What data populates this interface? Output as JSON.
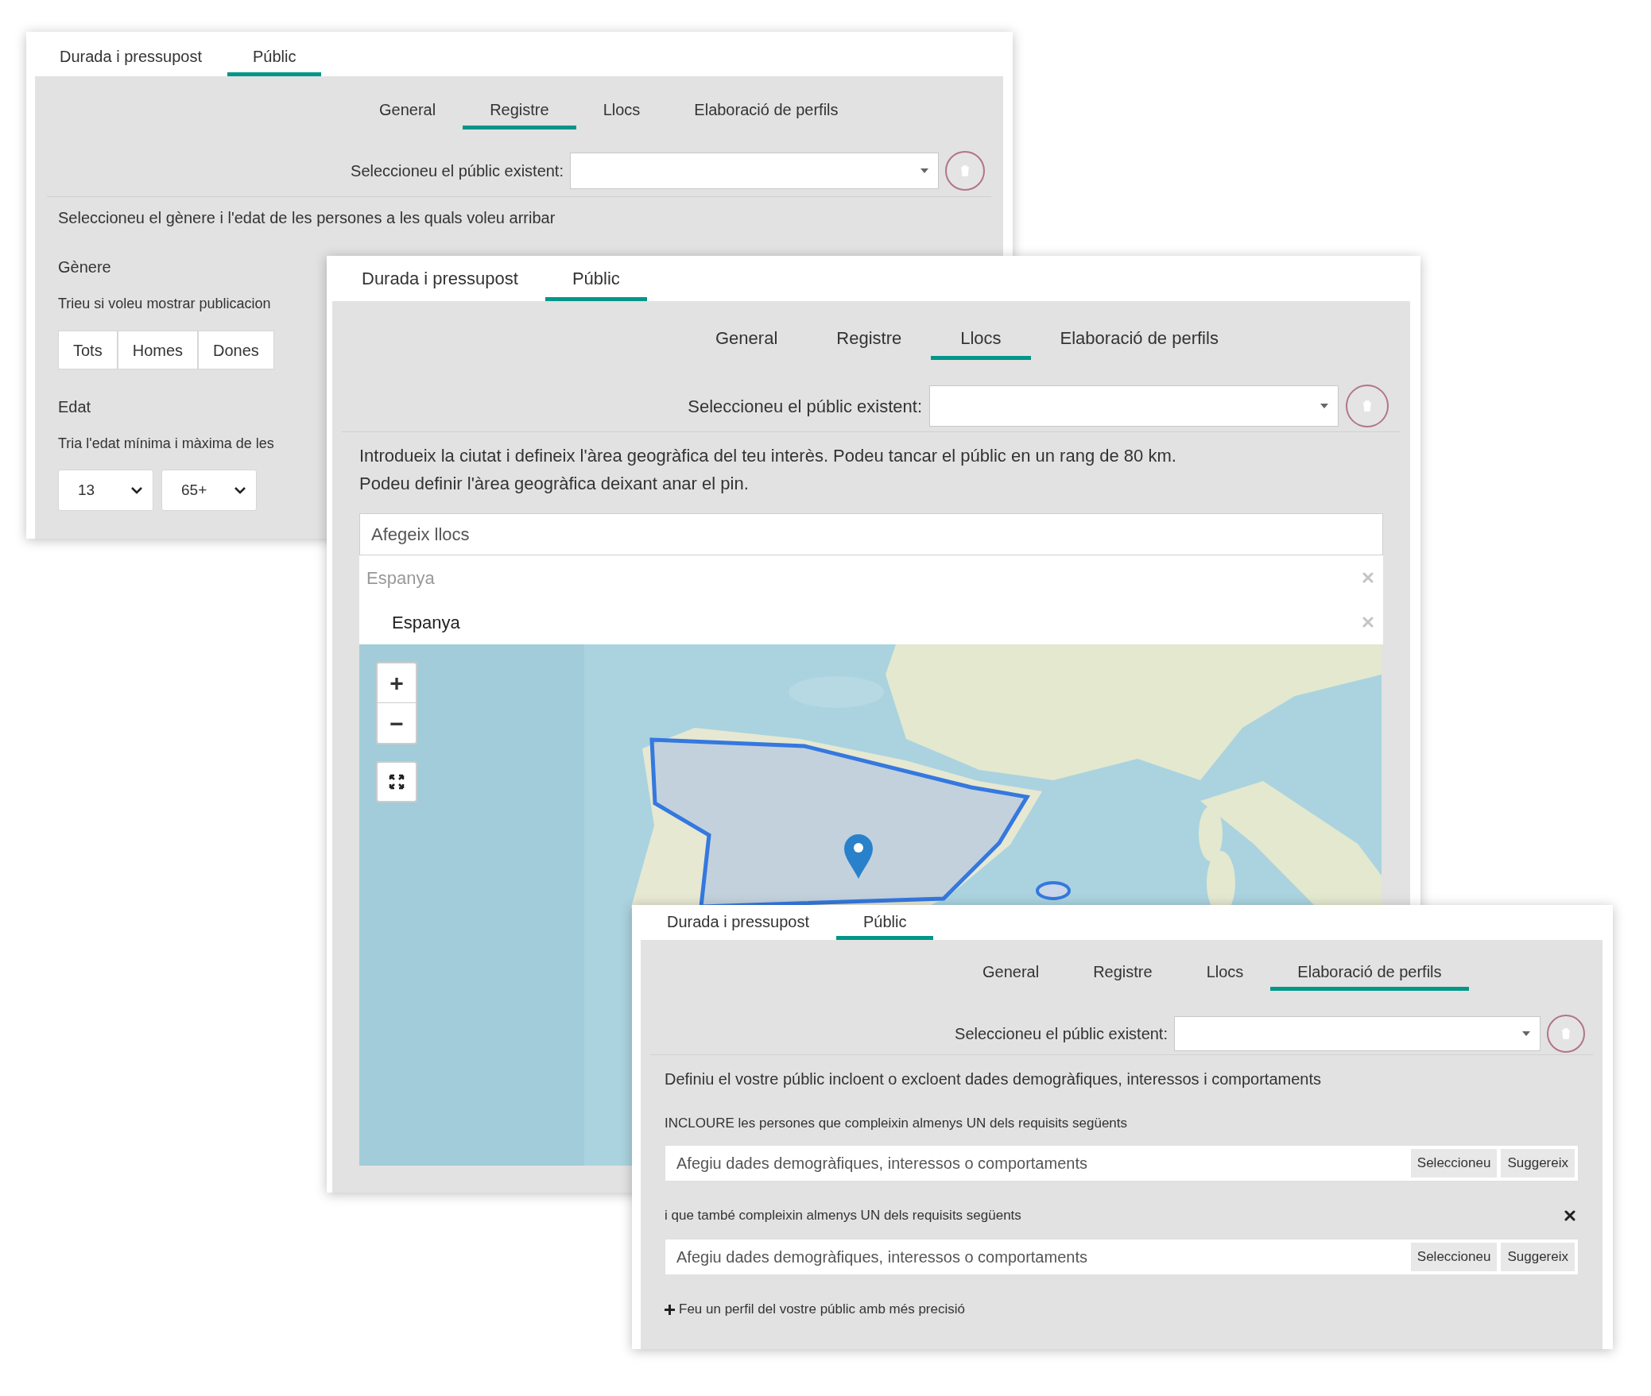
{
  "panels": [
    {
      "kind": "registre",
      "tabs": [
        {
          "label": "Durada i pressupost",
          "selected": false
        },
        {
          "label": "Públic",
          "selected": true
        }
      ],
      "subtabs": [
        {
          "label": "General",
          "selected": false
        },
        {
          "label": "Registre",
          "selected": true
        },
        {
          "label": "Llocs",
          "selected": false
        },
        {
          "label": "Elaboració de perfils",
          "selected": false
        }
      ],
      "audience_select": {
        "label": "Seleccioneu el públic existent:"
      },
      "description": "Seleccioneu el gènere i l'edat de les persones a les quals voleu arribar",
      "gender_label": "Gènere",
      "gender_hint": "Trieu si voleu mostrar publicacion",
      "gender_options": [
        "Tots",
        "Homes",
        "Dones"
      ],
      "age_label": "Edat",
      "age_hint": "Tria l'edat mínima i màxima de les",
      "age_selects": [
        "13",
        "65+"
      ]
    },
    {
      "kind": "llocs",
      "tabs": [
        {
          "label": "Durada i pressupost",
          "selected": false
        },
        {
          "label": "Públic",
          "selected": true
        }
      ],
      "subtabs": [
        {
          "label": "General",
          "selected": false
        },
        {
          "label": "Registre",
          "selected": false
        },
        {
          "label": "Llocs",
          "selected": true
        },
        {
          "label": "Elaboració de perfils",
          "selected": false
        }
      ],
      "audience_select": {
        "label": "Seleccioneu el públic existent:"
      },
      "description_lines": [
        "Introdueix la ciutat i defineix l'àrea geogràfica del teu interès. Podeu tancar el públic en un rang de 80 km.",
        "Podeu definir l'àrea geogràfica deixant anar el pin."
      ],
      "places_field": {
        "placeholder": "Afegeix llocs"
      },
      "places": [
        {
          "label": "Espanya",
          "kind": "group"
        },
        {
          "label": "Espanya",
          "kind": "item"
        }
      ],
      "map": {
        "kind": "picture",
        "zoom_in": "+",
        "zoom_out": "−"
      }
    },
    {
      "kind": "perfils",
      "tabs": [
        {
          "label": "Durada i pressupost",
          "selected": false
        },
        {
          "label": "Públic",
          "selected": true
        }
      ],
      "subtabs": [
        {
          "label": "General",
          "selected": false
        },
        {
          "label": "Registre",
          "selected": false
        },
        {
          "label": "Llocs",
          "selected": false
        },
        {
          "label": "Elaboració de perfils",
          "selected": true
        }
      ],
      "audience_select": {
        "label": "Seleccioneu el públic existent:"
      },
      "description": "Definiu el vostre públic incloent o excloent dades demogràfiques, interessos i comportaments",
      "groups": [
        {
          "label": "INCLOURE les persones que compleixin almenys UN dels requisits següents",
          "removable": false,
          "placeholder": "Afegiu dades demogràfiques, interessos o comportaments",
          "buttons": [
            "Seleccioneu",
            "Suggereix"
          ]
        },
        {
          "label": "i que també compleixin almenys UN dels requisits següents",
          "removable": true,
          "placeholder": "Afegiu dades demogràfiques, interessos o comportaments",
          "buttons": [
            "Seleccioneu",
            "Suggereix"
          ]
        }
      ],
      "add_link": "Feu un perfil del vostre públic amb més precisió"
    }
  ]
}
